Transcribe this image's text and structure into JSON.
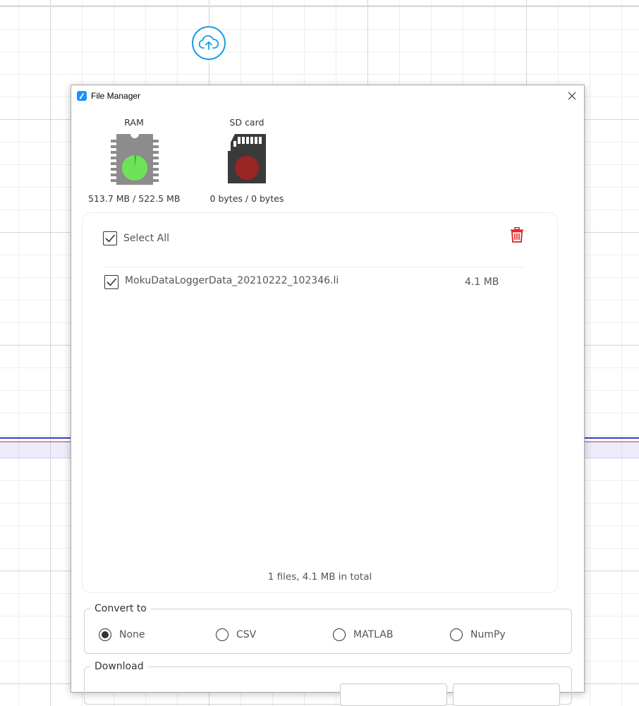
{
  "window": {
    "title": "File Manager",
    "close_icon": "close-icon"
  },
  "storage": {
    "ram": {
      "label": "RAM",
      "usage": "513.7 MB / 522.5 MB",
      "used_fraction": 0.983,
      "color": "#6ee35a"
    },
    "sd_card": {
      "label": "SD card",
      "usage": "0 bytes / 0 bytes",
      "used_fraction": 0,
      "color": "#9b2424"
    }
  },
  "files": {
    "select_all_label": "Select All",
    "select_all_checked": true,
    "delete_icon": "trash-icon",
    "delete_color": "#e11f1f",
    "items": [
      {
        "name": "MokuDataLoggerData_20210222_102346.li",
        "size": "4.1 MB",
        "checked": true
      }
    ],
    "summary": "1 files, 4.1 MB in total"
  },
  "convert": {
    "legend": "Convert to",
    "options": [
      "None",
      "CSV",
      "MATLAB",
      "NumPy"
    ],
    "selected": "None"
  },
  "download": {
    "legend": "Download"
  },
  "toolbar": {
    "upload_icon": "cloud-upload-icon",
    "accent": "#1ba0e2"
  }
}
